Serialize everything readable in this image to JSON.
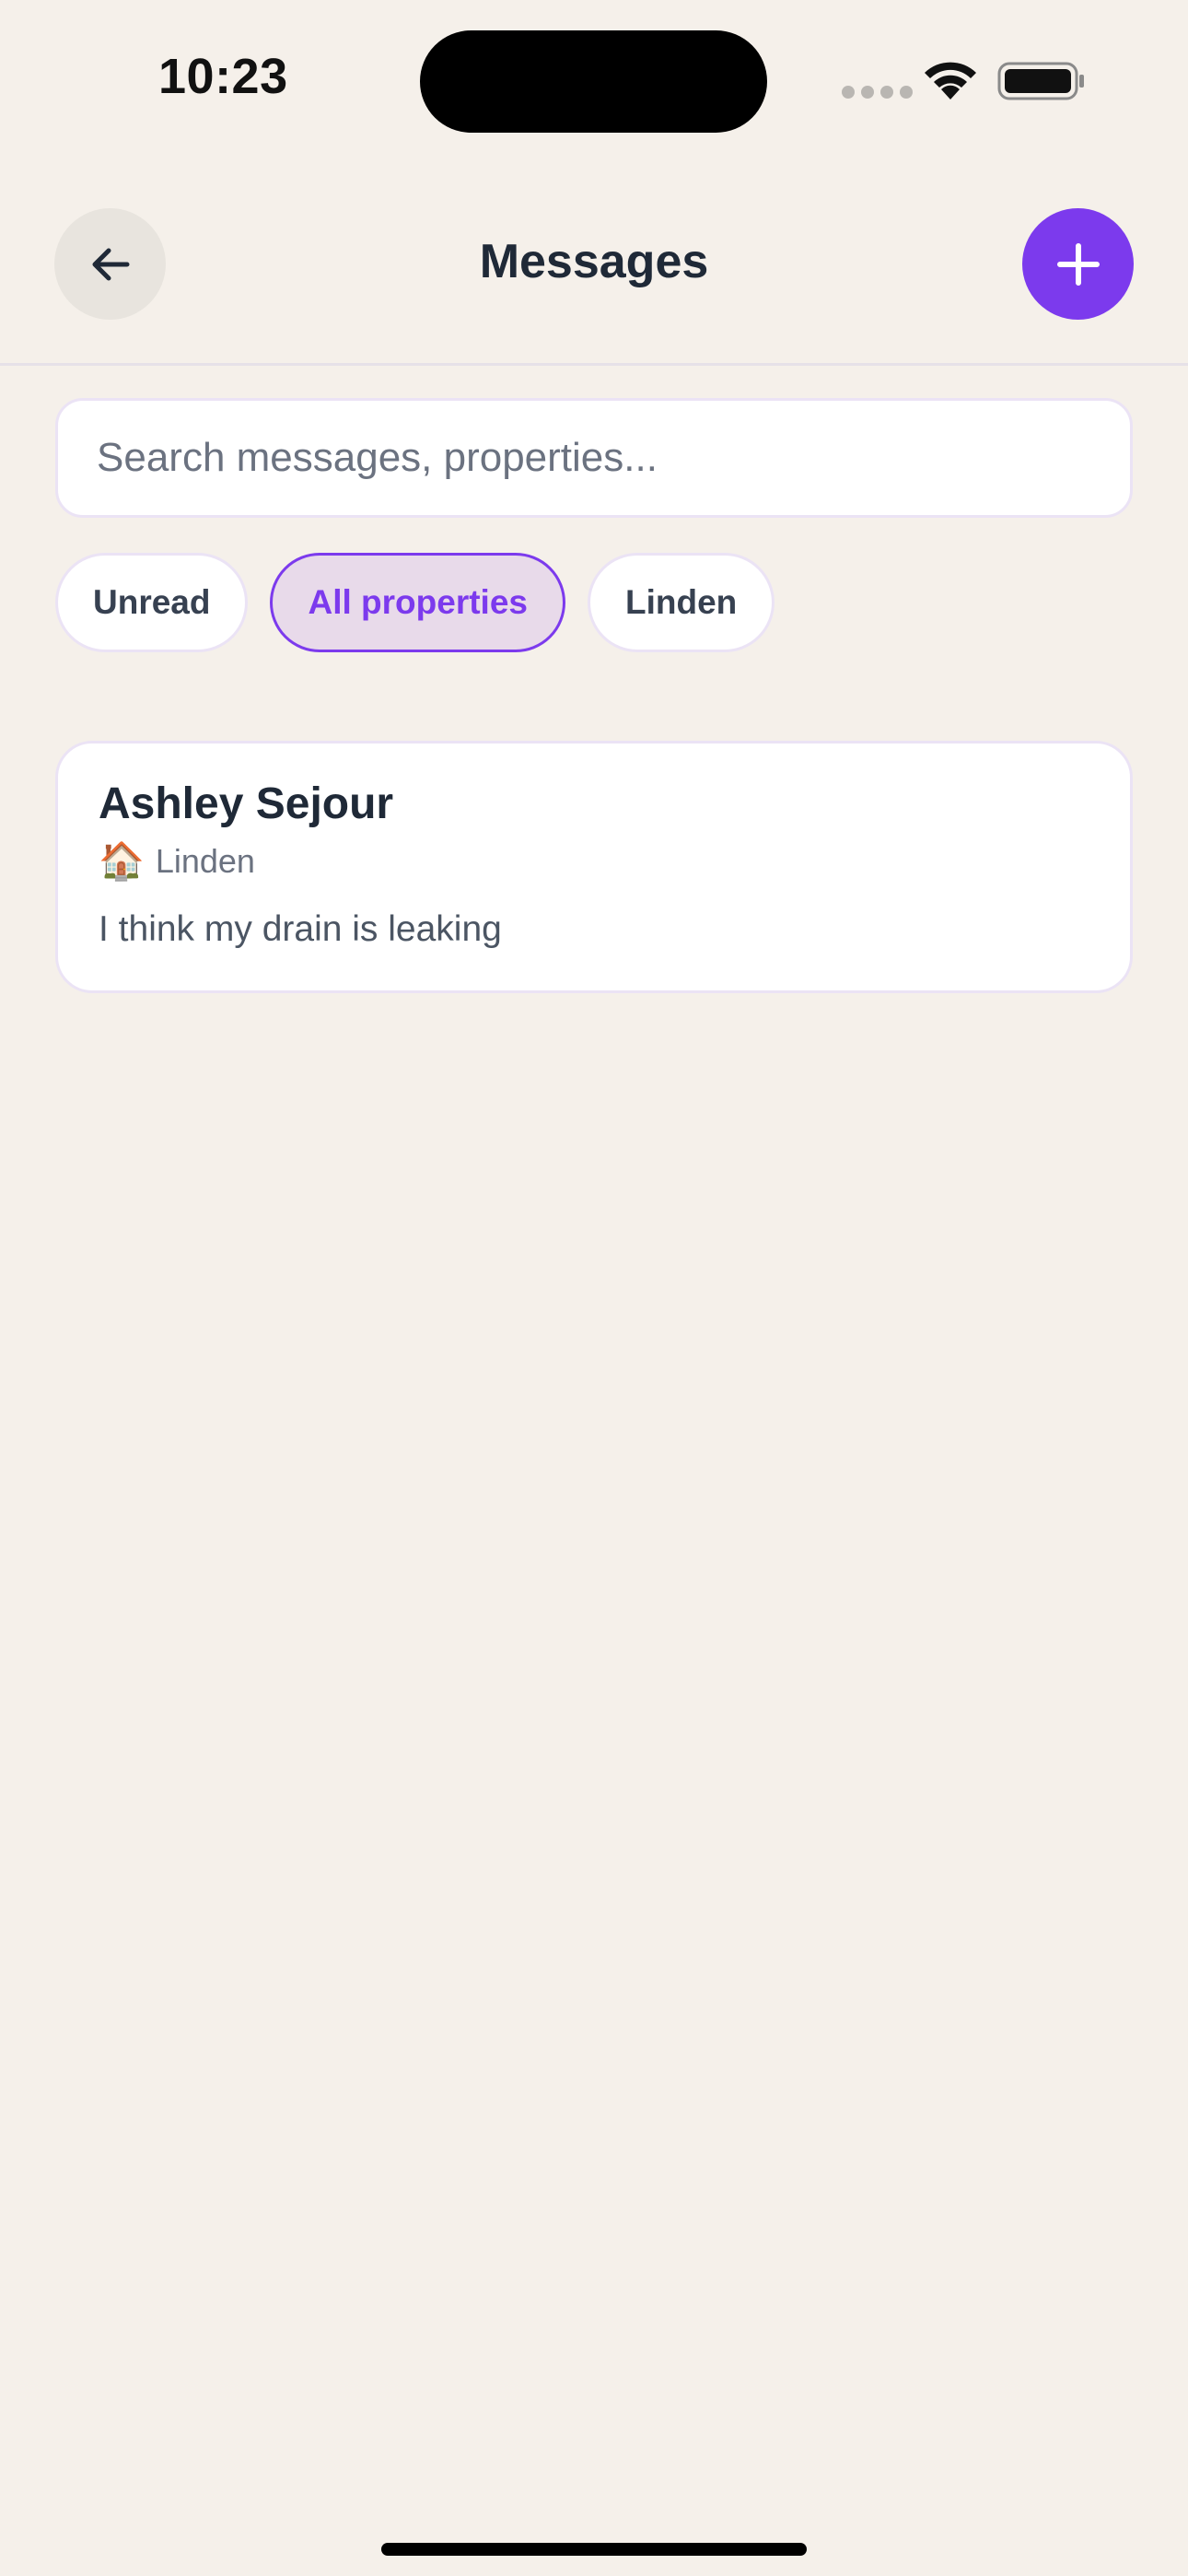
{
  "status_bar": {
    "time": "10:23"
  },
  "header": {
    "title": "Messages",
    "back_icon": "arrow-left-icon",
    "compose_icon": "plus-icon"
  },
  "search": {
    "value": "",
    "placeholder": "Search messages, properties..."
  },
  "filters": [
    {
      "label": "Unread",
      "active": false
    },
    {
      "label": "All properties",
      "active": true
    },
    {
      "label": "Linden",
      "active": false
    }
  ],
  "conversations": [
    {
      "name": "Ashley Sejour",
      "property_icon": "🏠",
      "property": "Linden",
      "preview": "I think my drain is leaking"
    }
  ],
  "colors": {
    "accent": "#7c3aed",
    "background": "#f5f0ea",
    "chip_active_bg": "#e8daea"
  }
}
